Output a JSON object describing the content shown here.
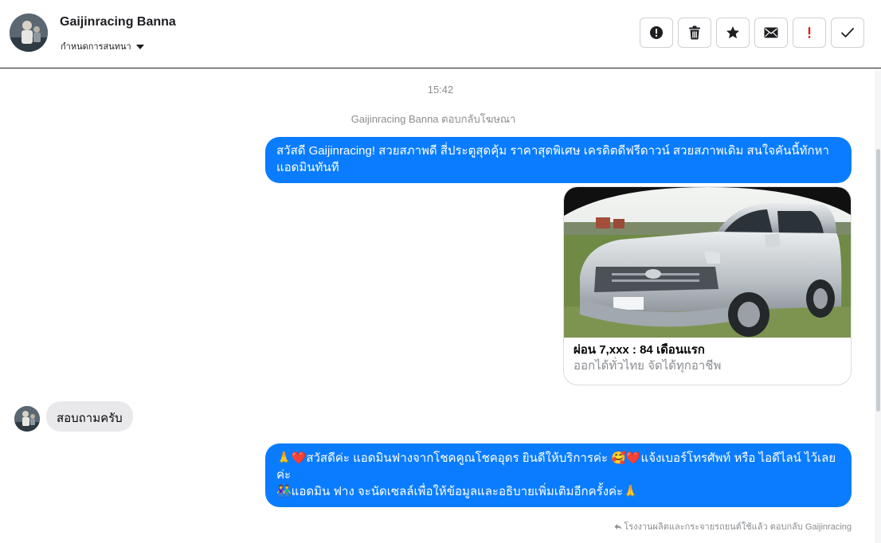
{
  "header": {
    "contact_name": "Gaijinracing Banna",
    "assign_label": "กำหนดการสนทนา"
  },
  "toolbar": {
    "buttons": [
      {
        "icon": "alert-circle-icon"
      },
      {
        "icon": "trash-icon"
      },
      {
        "icon": "star-icon"
      },
      {
        "icon": "envelope-icon"
      },
      {
        "icon": "exclamation-icon"
      },
      {
        "icon": "check-icon"
      }
    ]
  },
  "conversation": {
    "timestamp": "15:42",
    "system_note": "Gaijinracing Banna ตอบกลับโฆษณา",
    "messages": {
      "ad_text": "สวัสดี Gaijinracing! สวยสภาพดี สี่ประตูสุดคุ้ม ราคาสุดพิเศษ เครดิตดีฟรีดาวน์ สวยสภาพเดิม สนใจคันนี้ทักหาแอดมินทันที",
      "ad_card": {
        "title": "ผ่อน 7,xxx : 84 เดือนแรก",
        "subtitle": "ออกได้ทั่วไทย จัดได้ทุกอาชีพ"
      },
      "incoming_text": "สอบถามครับ",
      "reply_line1": "🙏❤️สวัสดีค่ะ แอดมินฟางจากโชคคูณโชคอุดร ยินดีให้บริการค่ะ 🥰❤️แจ้งเบอร์โทรศัพท์ หรือ ไอดีไลน์ ไว้เลยค่ะ",
      "reply_line2": "👫แอดมิน ฟาง จะนัดเซลล์เพื่อให้ข้อมูลและอธิบายเพิ่มเติมอีกครั้งค่ะ🙏"
    },
    "footer_note": "โรงงานผลิตและกระจายรถยนต์ใช้แล้ว ตอบกลับ Gaijinracing"
  },
  "colors": {
    "accent": "#0a7cff",
    "incoming_bubble": "#e9e9eb",
    "muted_text": "#8a8d91",
    "alert_red": "#e02020"
  }
}
